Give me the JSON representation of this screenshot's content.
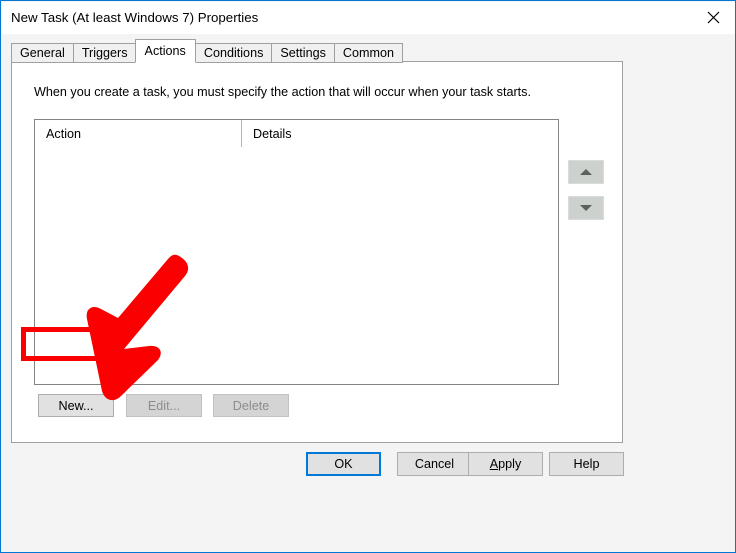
{
  "window": {
    "title": "New Task (At least Windows 7) Properties",
    "close_icon": "close-icon",
    "border_color": "#0078d7"
  },
  "tabs": [
    {
      "label": "General",
      "selected": false
    },
    {
      "label": "Triggers",
      "selected": false
    },
    {
      "label": "Actions",
      "selected": true
    },
    {
      "label": "Conditions",
      "selected": false
    },
    {
      "label": "Settings",
      "selected": false
    },
    {
      "label": "Common",
      "selected": false
    }
  ],
  "panel": {
    "description": "When you create a task, you must specify the action that will occur when your task starts.",
    "list": {
      "columns": [
        "Action",
        "Details"
      ],
      "rows": []
    },
    "move_buttons": [
      {
        "name": "move-up-button",
        "icon": "triangle-up-icon",
        "enabled": false
      },
      {
        "name": "move-down-button",
        "icon": "triangle-down-icon",
        "enabled": false
      }
    ],
    "action_buttons": [
      {
        "label": "New...",
        "enabled": true
      },
      {
        "label": "Edit...",
        "enabled": false
      },
      {
        "label": "Delete",
        "enabled": false
      }
    ]
  },
  "footer_buttons": [
    {
      "label": "OK",
      "default": true,
      "accel": ""
    },
    {
      "label": "Cancel",
      "default": false,
      "accel": ""
    },
    {
      "label": "Apply",
      "default": false,
      "accel": "A"
    },
    {
      "label": "Help",
      "default": false,
      "accel": ""
    }
  ],
  "annotations": {
    "highlight_color": "#fa0000",
    "arrow_color": "#fa0000",
    "highlight_target": "New...",
    "arrow_description": "red arrow pointing down-left at the New... button"
  }
}
